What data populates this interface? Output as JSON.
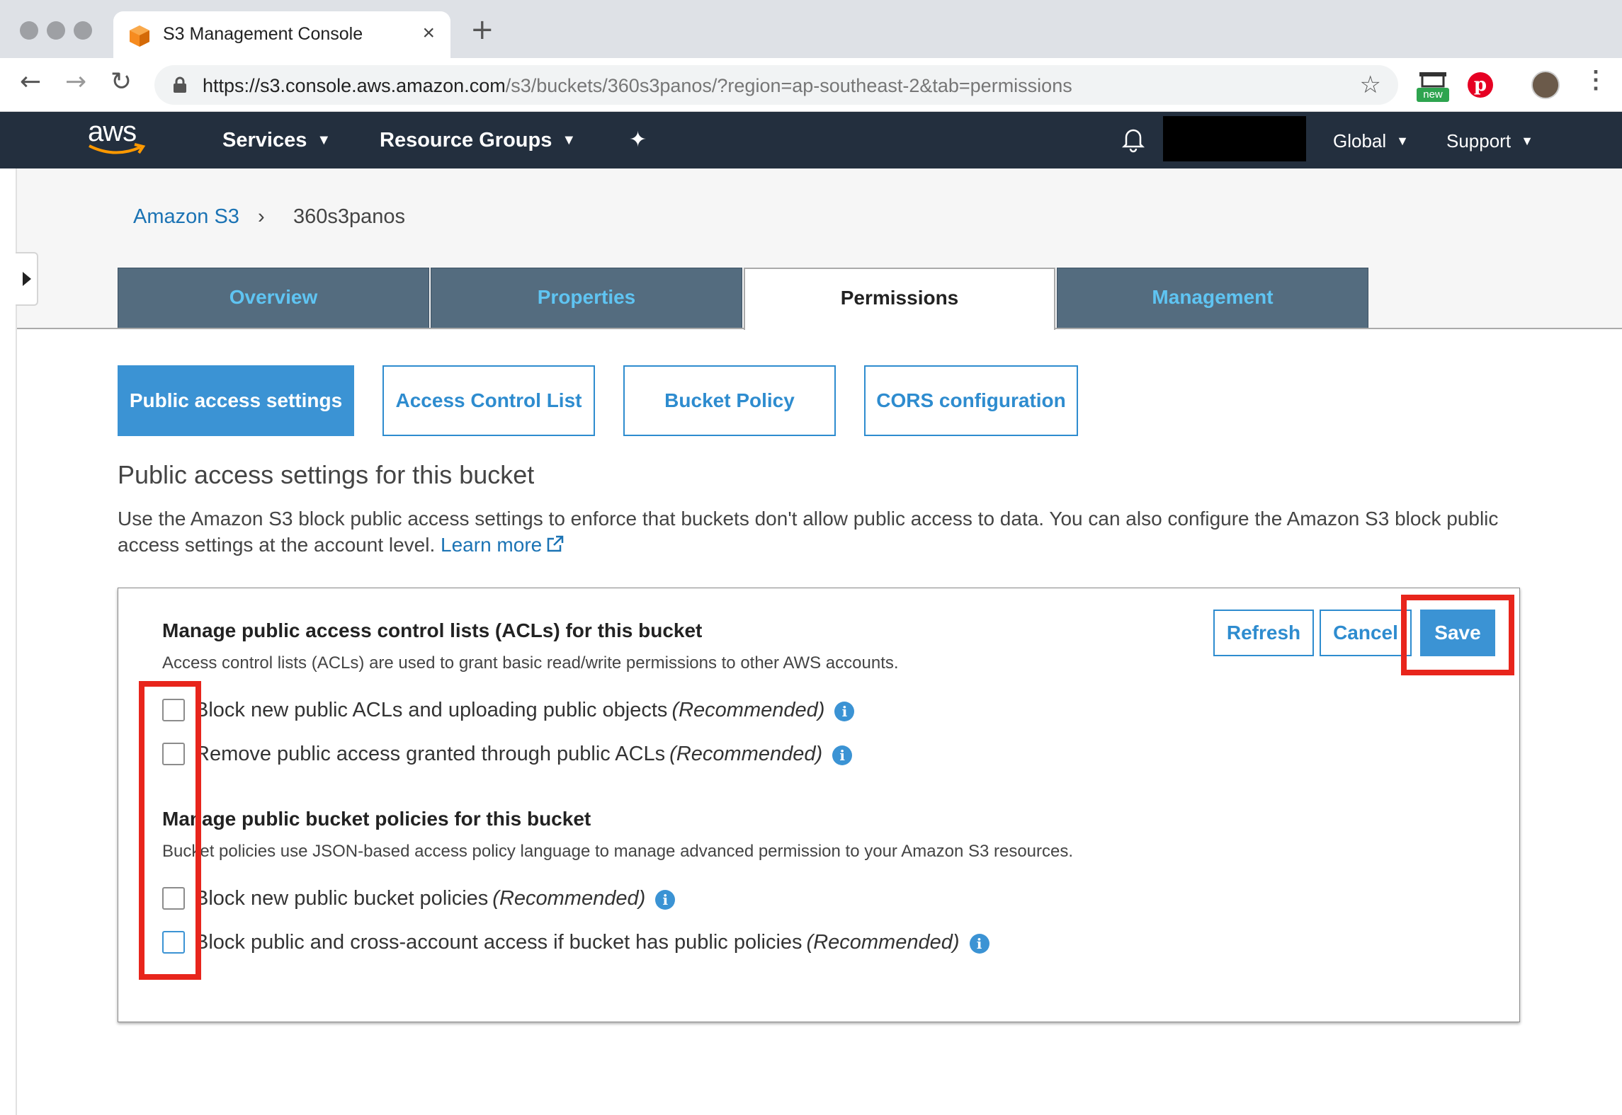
{
  "browser": {
    "tab_title": "S3 Management Console",
    "tab_close": "×",
    "new_tab": "+",
    "url_domain": "https://s3.console.aws.amazon.com",
    "url_path": "/s3/buckets/360s3panos/?region=ap-southeast-2&tab=permissions",
    "ext_badge": "new",
    "back": "←",
    "forward": "→",
    "reload": "↻",
    "star": "☆",
    "pinterest": "p",
    "menu": "⋮"
  },
  "aws_nav": {
    "logo_text": "aws",
    "services": "Services",
    "resource_groups": "Resource Groups",
    "global": "Global",
    "support": "Support",
    "caret": "▼",
    "pin": "✦"
  },
  "breadcrumb": {
    "root": "Amazon S3",
    "separator": "›",
    "current": "360s3panos"
  },
  "main_tabs": [
    {
      "label": "Overview"
    },
    {
      "label": "Properties"
    },
    {
      "label": "Permissions"
    },
    {
      "label": "Management"
    }
  ],
  "sub_tabs": [
    {
      "label": "Public access settings"
    },
    {
      "label": "Access Control List"
    },
    {
      "label": "Bucket Policy"
    },
    {
      "label": "CORS configuration"
    }
  ],
  "section": {
    "title": "Public access settings for this bucket",
    "description": "Use the Amazon S3 block public access settings to enforce that buckets don't allow public access to data. You can also configure the Amazon S3 block public access settings at the account level. ",
    "learn_more": "Learn more"
  },
  "panel": {
    "acl_heading": "Manage public access control lists (ACLs) for this bucket",
    "acl_sub": "Access control lists (ACLs) are used to grant basic read/write permissions to other AWS accounts.",
    "policy_heading": "Manage public bucket policies for this bucket",
    "policy_sub": "Bucket policies use JSON-based access policy language to manage advanced permission to your Amazon S3 resources.",
    "recommended": "(Recommended)",
    "info": "i",
    "options": [
      {
        "label": "Block new public ACLs and uploading public objects",
        "checked": false
      },
      {
        "label": "Remove public access granted through public ACLs",
        "checked": false
      },
      {
        "label": "Block new public bucket policies",
        "checked": false
      },
      {
        "label": "Block public and cross-account access if bucket has public policies",
        "checked": false
      }
    ],
    "buttons": {
      "refresh": "Refresh",
      "cancel": "Cancel",
      "save": "Save"
    }
  },
  "colors": {
    "aws_nav": "#232f3e",
    "tab_inactive": "#546c7f",
    "tab_text": "#5fc4f2",
    "accent": "#3b93d4",
    "link": "#1b73b4",
    "annotation": "#e8251c"
  }
}
